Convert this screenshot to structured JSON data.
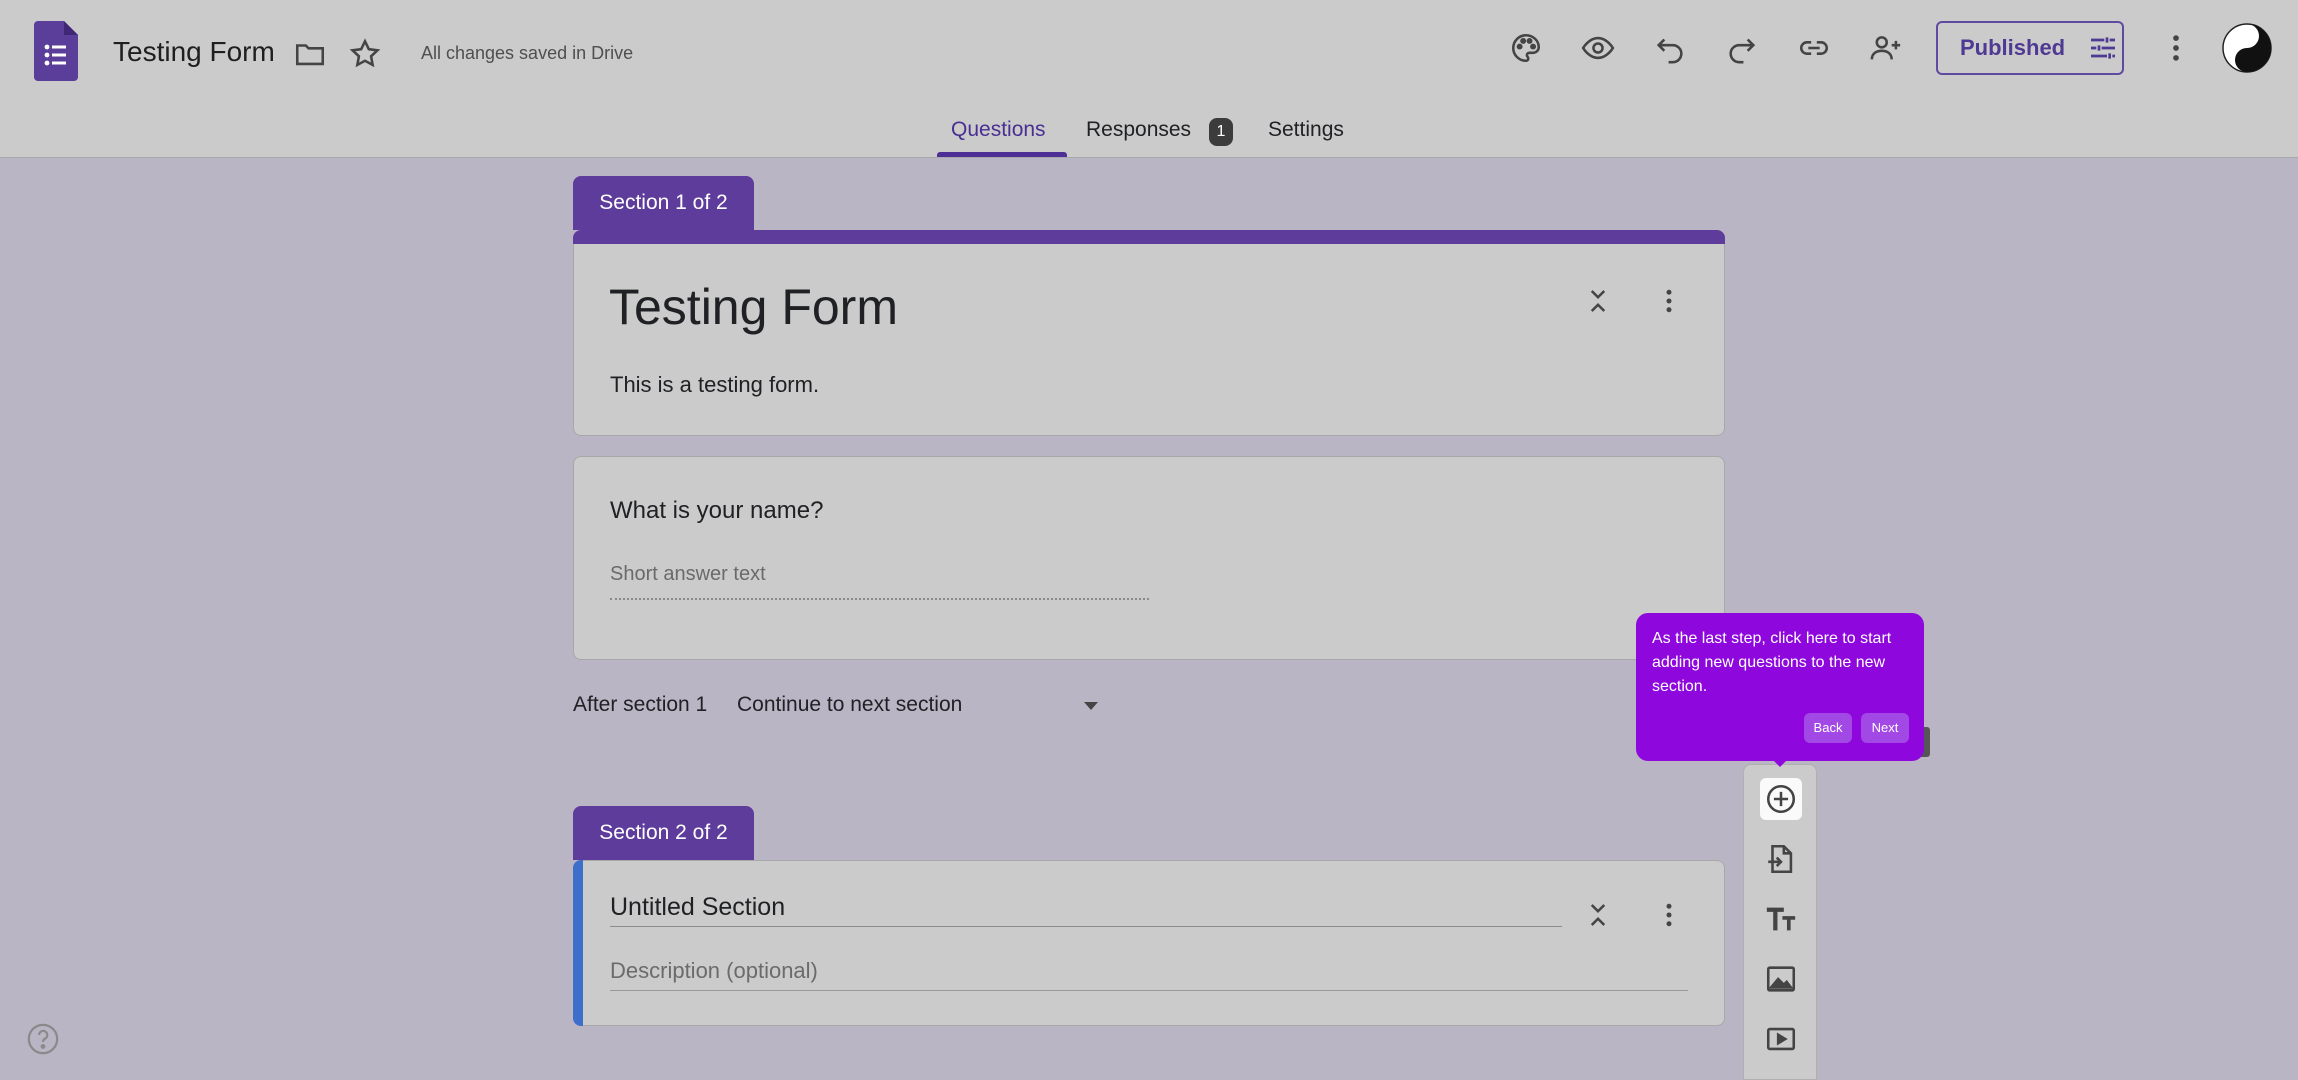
{
  "header": {
    "doc_title": "Testing Form",
    "save_status": "All changes saved in Drive",
    "publish_label": "Published",
    "icons": [
      "forms-logo-icon",
      "folder-icon",
      "star-icon",
      "palette-icon",
      "preview-eye-icon",
      "undo-icon",
      "redo-icon",
      "link-icon",
      "add-collaborator-icon",
      "tune-icon",
      "more-vert-icon",
      "avatar"
    ]
  },
  "tabs": {
    "questions": "Questions",
    "responses": "Responses",
    "responses_count": "1",
    "settings": "Settings"
  },
  "section1": {
    "tab_label": "Section 1 of 2",
    "title": "Testing Form",
    "description": "This is a testing form."
  },
  "question1": {
    "title": "What is your name?",
    "placeholder": "Short answer text"
  },
  "after_section": {
    "label": "After section 1",
    "value": "Continue to next section"
  },
  "section2": {
    "tab_label": "Section 2 of 2",
    "title": "Untitled Section",
    "description_placeholder": "Description (optional)"
  },
  "tooltip": {
    "text": "As the last step, click here to start adding new questions to the new section.",
    "back_label": "Back",
    "next_label": "Next"
  },
  "toolbar": {
    "items": [
      "add-question-icon",
      "import-questions-icon",
      "add-title-icon",
      "add-image-icon",
      "add-video-icon"
    ]
  },
  "colors": {
    "accent": "#5d3c9b",
    "tooltip": "#8e07dc",
    "section2_accent": "#3d6ec9"
  }
}
